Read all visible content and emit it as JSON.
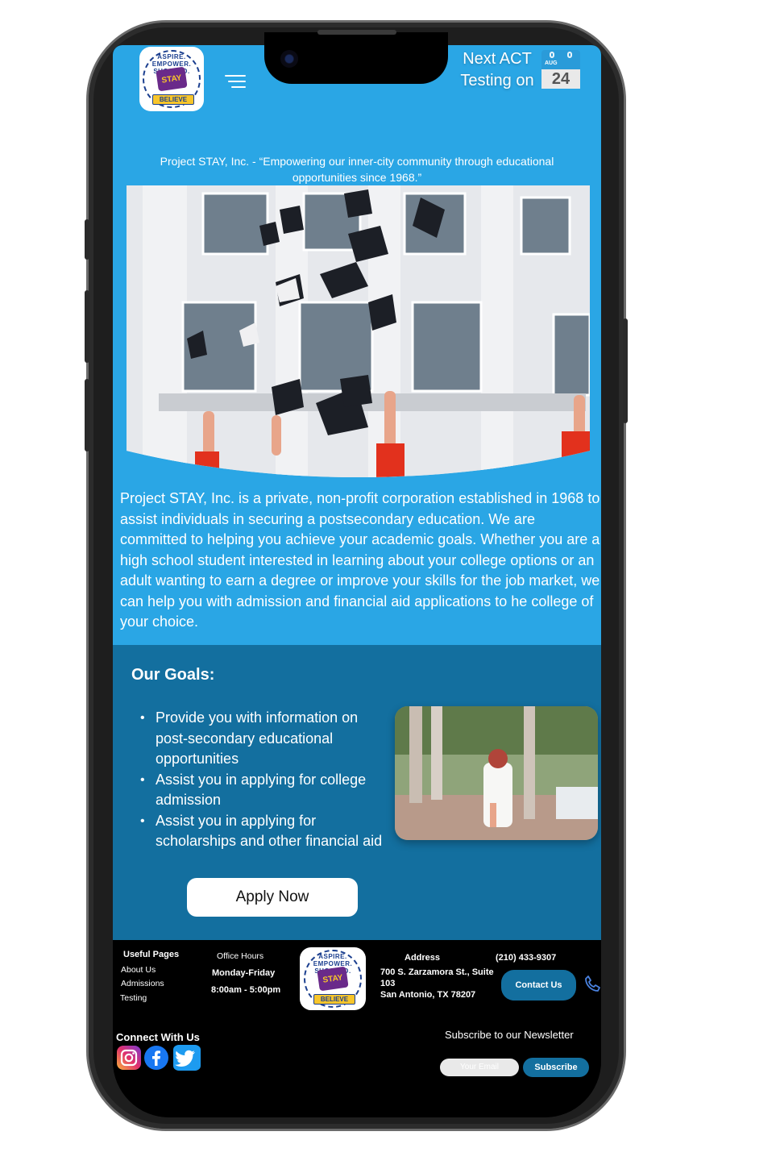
{
  "header": {
    "logo_arc_text": "ASPIRE. EMPOWER. SUCCEED.",
    "logo_core_text": "STAY",
    "logo_banner_text": "BELIEVE",
    "act_line1": "Next ACT",
    "act_line2": "Testing on",
    "act_month": "AUG",
    "act_day": "24"
  },
  "hero": {
    "tagline": "Project STAY, Inc. - “Empowering our inner-city community through educational opportunities since 1968.”",
    "intro": "Project STAY, Inc. is a private, non-profit corporation established in 1968 to assist individuals in securing a postsecondary education. We are committed to helping you achieve your academic goals. Whether you are a high school student interested in learning about your college options or an adult wanting to earn a degree or improve your skills for the job market, we can help you with admission and financial aid applications to he college of your choice."
  },
  "goals": {
    "title": "Our Goals:",
    "items": [
      "Provide you with information on post-secondary educational opportunities",
      "Assist you in applying for college admission",
      "Assist you in applying for scholarships and other financial aid"
    ],
    "apply_label": "Apply Now"
  },
  "footer": {
    "useful_title": "Useful Pages",
    "useful_links": [
      "About Us",
      "Admissions",
      "Testing"
    ],
    "hours_title": "Office Hours",
    "hours_days": "Monday-Friday",
    "hours_time": "8:00am - 5:00pm",
    "address_title": "Address",
    "address_line1": "700 S. Zarzamora St., Suite",
    "address_line2": "103",
    "address_line3": "San Antonio, TX 78207",
    "phone": "(210) 433-9307",
    "contact_label": "Contact Us",
    "connect_title": "Connect With Us",
    "newsletter_title": "Subscribe to our Newsletter",
    "email_placeholder": "Your Email",
    "subscribe_label": "Subscribe"
  },
  "colors": {
    "hero_bg": "#2aa6e5",
    "goals_bg": "#136f9f",
    "footer_bg": "#000000",
    "accent": "#136f9f"
  },
  "icons": [
    "menu-icon",
    "calendar-icon",
    "phone-icon",
    "instagram-icon",
    "facebook-icon",
    "twitter-icon"
  ]
}
